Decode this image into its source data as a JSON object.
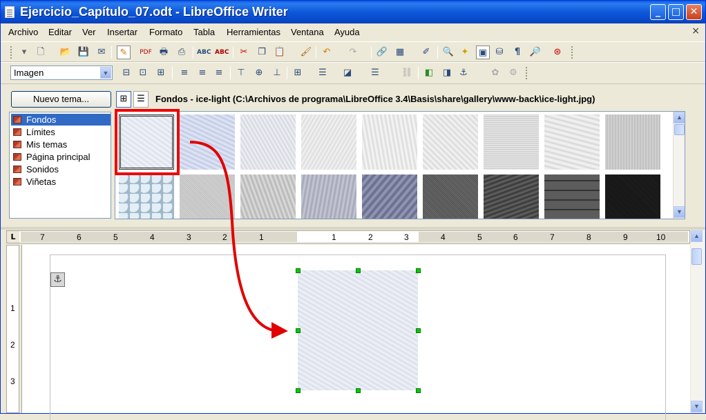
{
  "window": {
    "title": "Ejercicio_Capítulo_07.odt - LibreOffice Writer",
    "buttons": {
      "minimize": "_",
      "maximize": "□",
      "close": "✕"
    }
  },
  "menubar": {
    "items": [
      "Archivo",
      "Editar",
      "Ver",
      "Insertar",
      "Formato",
      "Tabla",
      "Herramientas",
      "Ventana",
      "Ayuda"
    ],
    "close_glyph": "×"
  },
  "frame_toolbar": {
    "style_value": "Imagen",
    "style_arrow": "▼"
  },
  "gallery": {
    "new_theme_label": "Nuevo tema...",
    "themes": [
      "Fondos",
      "Límites",
      "Mis temas",
      "Página principal",
      "Sonidos",
      "Viñetas"
    ],
    "selected_theme": "Fondos",
    "path_label": "Fondos - ice-light (C:\\Archivos de programa\\LibreOffice 3.4\\Basis\\share\\gallery\\www-back\\ice-light.jpg)",
    "scroll_up": "▲",
    "scroll_down": "▼"
  },
  "ruler": {
    "corner_glyph": "L",
    "h_numbers": [
      "7",
      "6",
      "5",
      "4",
      "3",
      "2",
      "1",
      "1",
      "2",
      "3",
      "4",
      "5",
      "6",
      "7",
      "8",
      "9",
      "10"
    ],
    "v_numbers": [
      "1",
      "2",
      "3"
    ]
  },
  "document": {
    "anchor_glyph": "⚓",
    "inserted_image": "ice-light"
  },
  "colors": {
    "titlebar": "#0a5be2",
    "selection_highlight": "#316ac5",
    "callout_red": "#e00000",
    "handle_green": "#00cc00"
  }
}
